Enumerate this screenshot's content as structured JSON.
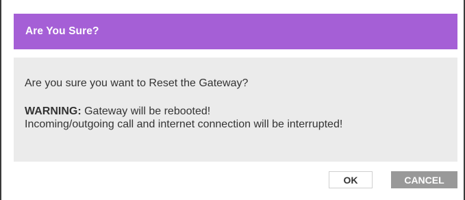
{
  "dialog": {
    "title": "Are You Sure?",
    "question": "Are you sure you want to Reset the Gateway?",
    "warning_label": "WARNING:",
    "warning_text": " Gateway will be rebooted!",
    "detail": "Incoming/outgoing call and internet connection will be interrupted!",
    "ok_label": "OK",
    "cancel_label": "CANCEL"
  },
  "colors": {
    "header_background": "#a55fd6",
    "body_background": "#ebebeb",
    "cancel_background": "#999999"
  }
}
